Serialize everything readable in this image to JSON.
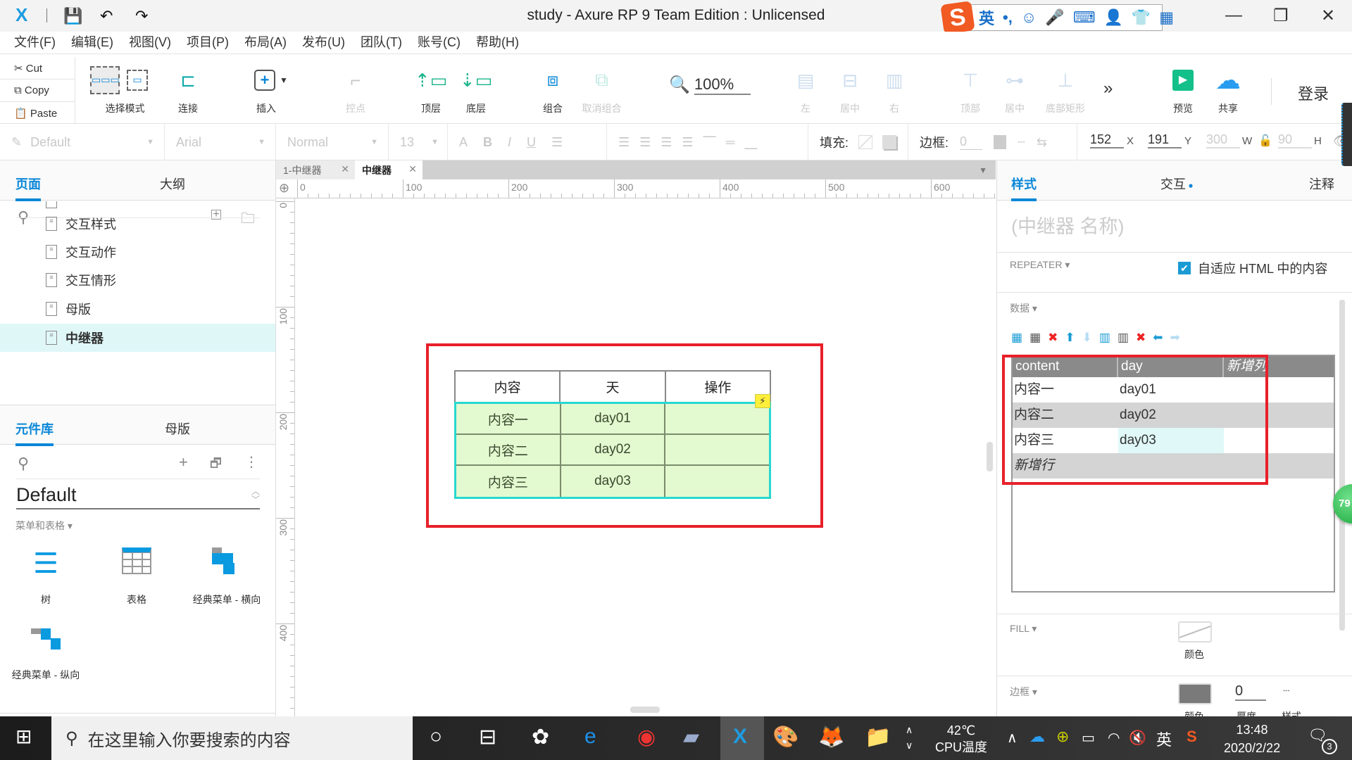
{
  "window": {
    "title": "study - Axure RP 9 Team Edition : Unlicensed",
    "controls": {
      "minimize": "—",
      "maximize": "❐",
      "close": "✕"
    }
  },
  "ime": {
    "mode": "英",
    "punct": "•,"
  },
  "menu": [
    "文件(F)",
    "编辑(E)",
    "视图(V)",
    "项目(P)",
    "布局(A)",
    "发布(U)",
    "团队(T)",
    "账号(C)",
    "帮助(H)"
  ],
  "clipboard": {
    "cut": "Cut",
    "copy": "Copy",
    "paste": "Paste"
  },
  "toolbar": {
    "select_mode": "选择模式",
    "connect": "连接",
    "insert": "插入",
    "anchor": "控点",
    "top_layer": "顶层",
    "bottom_layer": "底层",
    "group": "组合",
    "ungroup": "取消组合",
    "zoom": "100%",
    "align_left": "左",
    "align_center": "居中",
    "align_right": "右",
    "align_top": "顶部",
    "align_middle": "居中",
    "align_bottom": "底部矩形",
    "more": "»",
    "preview": "预览",
    "share": "共享",
    "login": "登录"
  },
  "stylebar": {
    "style": "Default",
    "font": "Arial",
    "weight": "Normal",
    "size": "13",
    "fill_label": "填充:",
    "border_label": "边框:",
    "border_width": "0",
    "x": "152",
    "x_label": "X",
    "y": "191",
    "y_label": "Y",
    "w": "300",
    "w_label": "W",
    "h": "90",
    "h_label": "H"
  },
  "pages_panel": {
    "tabs": [
      "页面",
      "大纲"
    ],
    "items": [
      "交互样式",
      "交互动作",
      "交互情形",
      "母版",
      "中继器"
    ],
    "selected": "中继器"
  },
  "library_panel": {
    "tabs": [
      "元件库",
      "母版"
    ],
    "library": "Default",
    "category": "菜单和表格 ▾",
    "widgets": [
      "树",
      "表格",
      "经典菜单 - 横向",
      "经典菜单 - 纵向"
    ]
  },
  "doc_tabs": [
    {
      "label": "1-中继器",
      "active": false
    },
    {
      "label": "中继器",
      "active": true
    }
  ],
  "rulers": {
    "h": [
      "0",
      "100",
      "200",
      "300",
      "400",
      "500",
      "600"
    ],
    "v": [
      "0",
      "100",
      "200",
      "300",
      "400"
    ]
  },
  "canvas_table": {
    "headers": [
      "内容",
      "天",
      "操作"
    ],
    "rows": [
      [
        "内容一",
        "day01",
        ""
      ],
      [
        "内容二",
        "day02",
        ""
      ],
      [
        "内容三",
        "day03",
        ""
      ]
    ]
  },
  "inspector": {
    "tabs": [
      "样式",
      "交互",
      "注释"
    ],
    "name_placeholder": "(中继器 名称)",
    "repeater_label": "REPEATER ▾",
    "fit_html": "自适应 HTML 中的内容",
    "fit_html_checked": true,
    "data_label": "数据 ▾",
    "data_columns": [
      "content",
      "day"
    ],
    "add_column": "新增列",
    "data_rows": [
      [
        "内容一",
        "day01"
      ],
      [
        "内容二",
        "day02"
      ],
      [
        "内容三",
        "day03"
      ]
    ],
    "add_row": "新增行",
    "fill_label": "FILL ▾",
    "fill_color_label": "颜色",
    "border_label": "边框 ▾",
    "border_color_label": "颜色",
    "border_thickness": "0",
    "border_thickness_label": "厚度",
    "border_style_label": "样式"
  },
  "badge": "79",
  "taskbar": {
    "search_placeholder": "在这里输入你要搜索的内容",
    "cpu_temp": "42℃",
    "cpu_label": "CPU温度",
    "ime": "英",
    "time": "13:48",
    "date": "2020/2/22",
    "notifications": "3"
  },
  "colors": {
    "accent": "#0a87d8",
    "highlight_red": "#e8202a",
    "row_green": "#e3f9cf",
    "selection_cyan": "#28d8d0"
  }
}
